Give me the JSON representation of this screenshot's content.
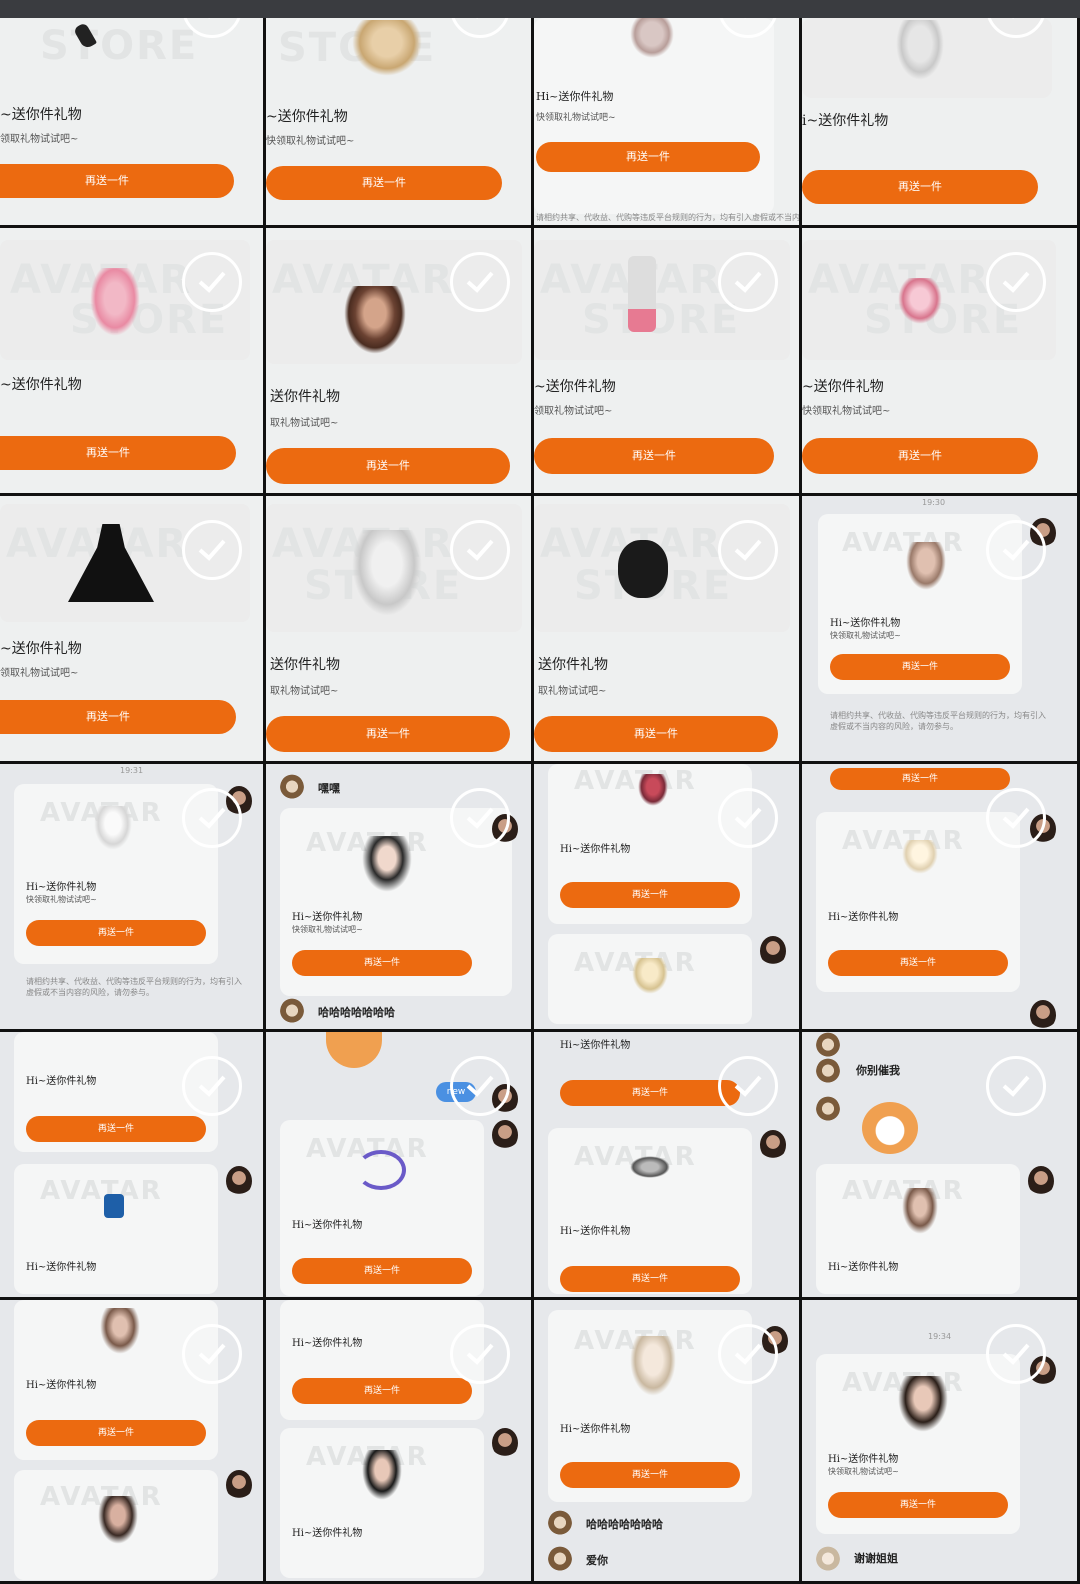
{
  "gift_card": {
    "title_full": "Hi~送你件礼物",
    "title_partial_a": "~送你件礼物",
    "title_partial_b": "送你件礼物",
    "title_partial_c": "i~送你件礼物",
    "subtitle_full": "快领取礼物试试吧~",
    "subtitle_partial_a": "领取礼物试试吧~",
    "subtitle_partial_b": "取礼物试试吧~",
    "button": "再送一件",
    "watermark_line1": "AVATAR",
    "watermark_line2": "STORE",
    "notice": "请相约共享、代收益、代购等违反平台规则的行为，均有引入虚假或不当内容的风险，请勿参与。"
  },
  "chat": {
    "msg_hehe": "嘿嘿",
    "msg_haha": "哈哈哈哈哈哈哈",
    "msg_nizhui": "你别催我",
    "msg_xiexie": "谢谢姐姐",
    "msg_aini": "爱你",
    "badge_new": "new",
    "time_1": "19:30",
    "time_2": "19:31",
    "time_3": "19:34"
  },
  "selection": {
    "checked_count": 24
  },
  "colors": {
    "accent": "#ec6a10",
    "background": "#eef0f0",
    "chat_bg": "#e6e8eb",
    "divider": "#111111"
  }
}
